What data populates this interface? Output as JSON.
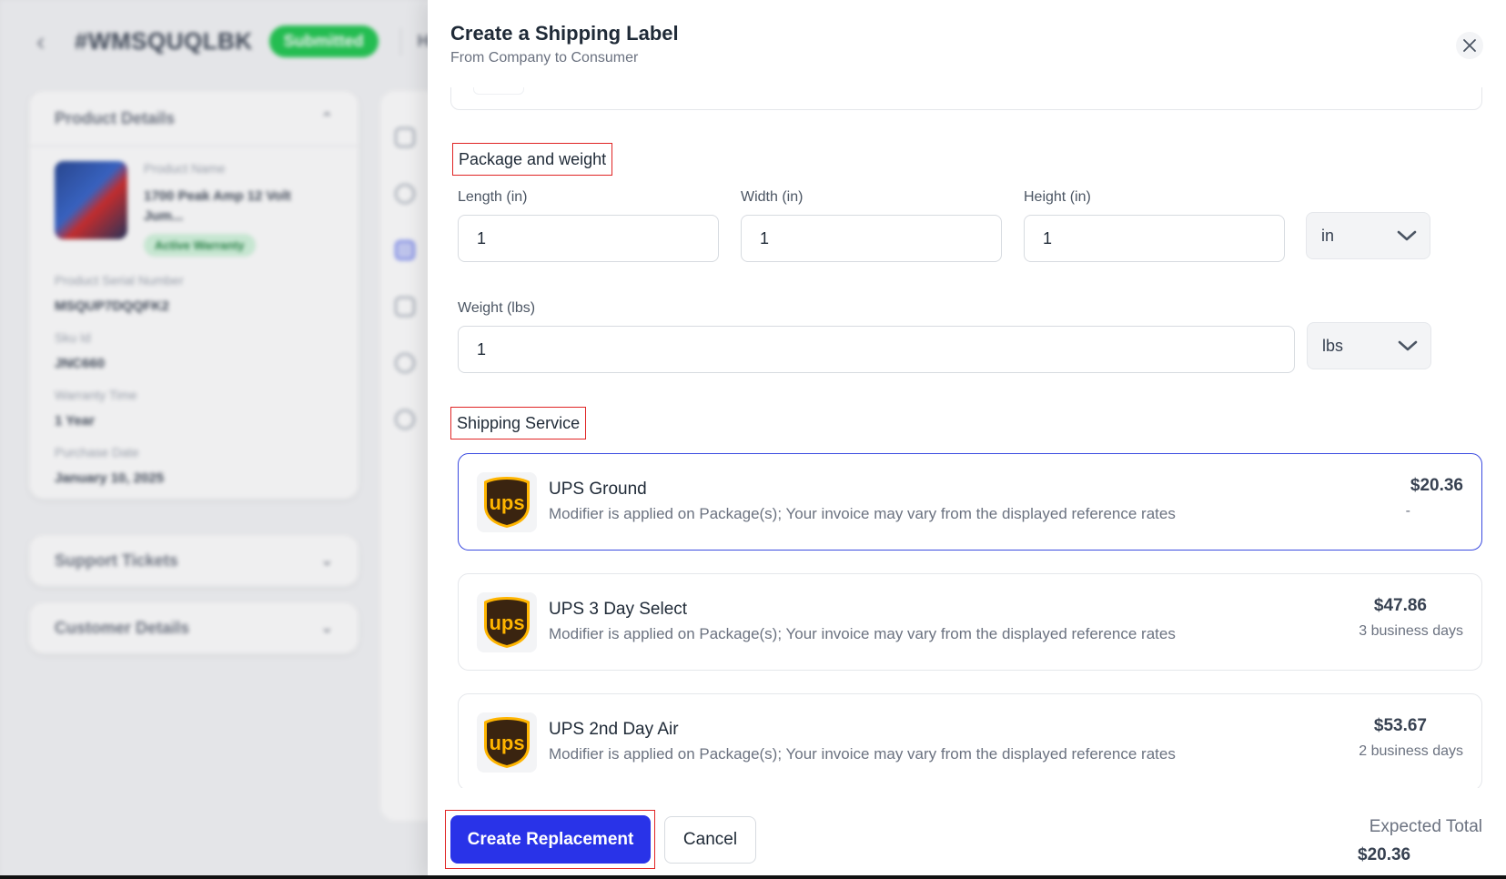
{
  "background": {
    "order_id": "#WMSQUQLBK",
    "status": "Submitted",
    "priority": "High",
    "product_details": {
      "title": "Product Details",
      "product_name_label": "Product Name",
      "product_name": "1700 Peak Amp 12 Volt Jum...",
      "warranty_badge": "Active Warranty",
      "serial_label": "Product Serial Number",
      "serial_value": "MSQUP7DQQFK2",
      "sku_label": "Sku Id",
      "sku_value": "JNC660",
      "warranty_time_label": "Warranty Time",
      "warranty_time_value": "1 Year",
      "purchase_date_label": "Purchase Date",
      "purchase_date_value": "January 10, 2025"
    },
    "support_tickets_title": "Support Tickets",
    "customer_details_title": "Customer Details"
  },
  "drawer": {
    "title": "Create a Shipping Label",
    "subtitle": "From Company to Consumer",
    "package_section": {
      "heading": "Package and weight",
      "length_label": "Length (in)",
      "length_value": "1",
      "width_label": "Width (in)",
      "width_value": "1",
      "height_label": "Height (in)",
      "height_value": "1",
      "dimension_unit": "in",
      "weight_label": "Weight (lbs)",
      "weight_value": "1",
      "weight_unit": "lbs"
    },
    "shipping_section": {
      "heading": "Shipping Service",
      "services": [
        {
          "name": "UPS Ground",
          "description": "Modifier is applied on Package(s); Your invoice may vary from the displayed reference rates",
          "price": "$20.36",
          "eta": "-",
          "selected": true
        },
        {
          "name": "UPS 3 Day Select",
          "description": "Modifier is applied on Package(s); Your invoice may vary from the displayed reference rates",
          "price": "$47.86",
          "eta": "3 business days",
          "selected": false
        },
        {
          "name": "UPS 2nd Day Air",
          "description": "Modifier is applied on Package(s); Your invoice may vary from the displayed reference rates",
          "price": "$53.67",
          "eta": "2 business days",
          "selected": false
        }
      ]
    },
    "footer": {
      "primary_label": "Create Replacement",
      "cancel_label": "Cancel",
      "expected_total_label": "Expected Total",
      "expected_total_value": "$20.36"
    }
  },
  "colors": {
    "primary": "#2933e8",
    "selected_border": "#3b4be0",
    "highlight_box": "#e02424",
    "status_green": "#19c64b",
    "ups_brown": "#3a2410",
    "ups_gold": "#ffb500"
  },
  "icons": {
    "back": "chevron-left-icon",
    "close": "close-icon",
    "select": "chevron-down-icon",
    "carrier": "ups-logo"
  }
}
